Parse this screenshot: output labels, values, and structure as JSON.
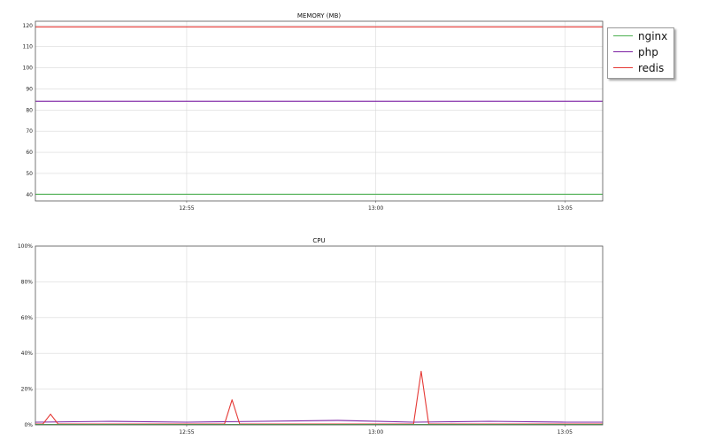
{
  "chart_data": [
    {
      "type": "line",
      "title": "MEMORY (MB)",
      "xlabel": "",
      "ylabel": "",
      "x_range": [
        "12:51",
        "13:06"
      ],
      "x_ticks": [
        "12:55",
        "13:00",
        "13:05"
      ],
      "ylim": [
        37,
        122
      ],
      "y_ticks": [
        40,
        50,
        60,
        70,
        80,
        90,
        100,
        110,
        120
      ],
      "grid": true,
      "legend": "outside-top-right",
      "series": [
        {
          "name": "nginx",
          "color": "#4caf50",
          "x": [
            "12:51",
            "13:06"
          ],
          "values": [
            40.2,
            40.2
          ]
        },
        {
          "name": "php",
          "color": "#7b1fa2",
          "x": [
            "12:51",
            "13:06"
          ],
          "values": [
            84.2,
            84.2
          ]
        },
        {
          "name": "redis",
          "color": "#e53935",
          "x": [
            "12:51",
            "13:06"
          ],
          "values": [
            119.3,
            119.3
          ]
        }
      ]
    },
    {
      "type": "line",
      "title": "CPU",
      "xlabel": "",
      "ylabel": "",
      "x_range": [
        "12:51",
        "13:06"
      ],
      "x_ticks": [
        "12:55",
        "13:00",
        "13:05"
      ],
      "ylim": [
        0,
        100
      ],
      "y_ticks": [
        "0%",
        "20%",
        "40%",
        "60%",
        "80%",
        "100%"
      ],
      "grid": true,
      "series": [
        {
          "name": "php",
          "color": "#7b1fa2",
          "x": [
            "12:51",
            "12:53",
            "12:55",
            "12:57",
            "12:59",
            "13:01",
            "13:03",
            "13:05",
            "13:06"
          ],
          "values": [
            1.5,
            2,
            1.5,
            2,
            2.5,
            1.5,
            2,
            1.5,
            1.5
          ]
        },
        {
          "name": "redis",
          "color": "#e53935",
          "x": [
            "12:51",
            "12:51:12",
            "12:51:24",
            "12:51:36",
            "12:56:00",
            "12:56:12",
            "12:56:24",
            "13:01:00",
            "13:01:12",
            "13:01:24",
            "13:06"
          ],
          "values": [
            0.5,
            0.5,
            6,
            0.5,
            0.5,
            14,
            0.5,
            0.5,
            30,
            0.5,
            0.5
          ]
        },
        {
          "name": "nginx",
          "color": "#4caf50",
          "x": [
            "12:51",
            "13:06"
          ],
          "values": [
            0.2,
            0.2
          ]
        }
      ]
    }
  ],
  "legend": {
    "items": [
      {
        "label": "nginx",
        "color": "#4caf50"
      },
      {
        "label": "php",
        "color": "#7b1fa2"
      },
      {
        "label": "redis",
        "color": "#e53935"
      }
    ]
  }
}
